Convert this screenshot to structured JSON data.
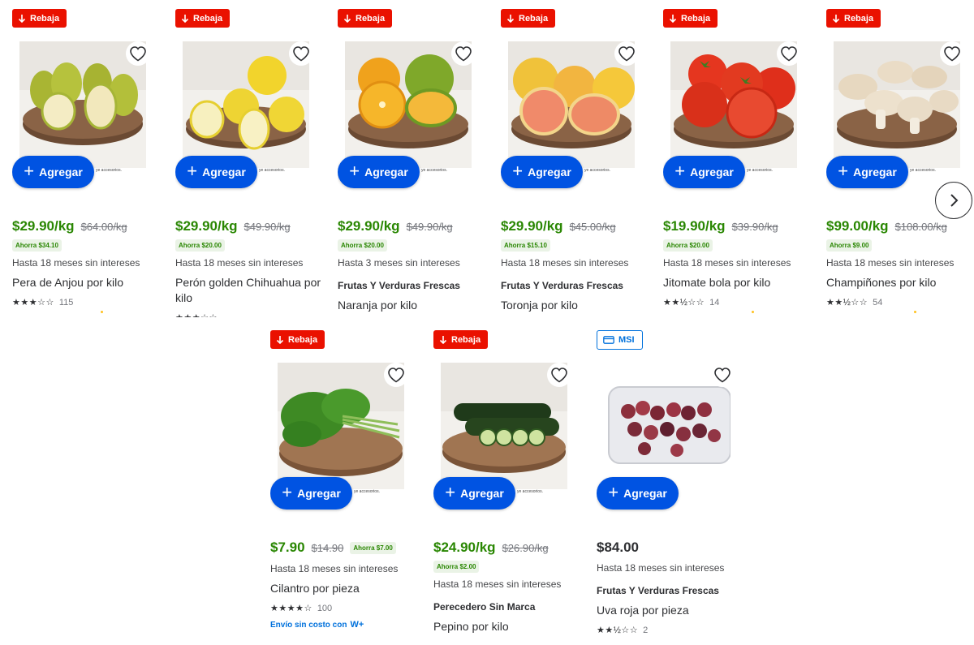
{
  "add_label": "Agregar",
  "disclaimer": "ye accesorios.",
  "flags": {
    "rebaja": "Rebaja",
    "msi": "MSI"
  },
  "colors": {
    "rebaja": "#ea1100",
    "price_green": "#2a8703",
    "button_blue": "#0053e2",
    "link_blue": "#0071dc"
  },
  "products": [
    {
      "flag": "Rebaja",
      "price": "$29.90/kg",
      "was": "$64.00/kg",
      "save": "Ahorra $34.10",
      "msi": "Hasta 18 meses sin intereses",
      "brand": "",
      "name": "Pera de Anjou por kilo",
      "stars": "★★★☆☆",
      "reviews": "115",
      "image": "pears"
    },
    {
      "flag": "Rebaja",
      "price": "$29.90/kg",
      "was": "$49.90/kg",
      "save": "Ahorra $20.00",
      "msi": "Hasta 18 meses sin intereses",
      "brand": "",
      "name": "Perón golden Chihuahua por kilo",
      "stars": "★★★☆☆",
      "reviews": "",
      "image": "yellow-apples"
    },
    {
      "flag": "Rebaja",
      "price": "$29.90/kg",
      "was": "$49.90/kg",
      "save": "Ahorra $20.00",
      "msi": "Hasta 3 meses sin intereses",
      "brand": "Frutas Y Verduras Frescas",
      "name": "Naranja por kilo",
      "stars": "",
      "reviews": "",
      "image": "oranges"
    },
    {
      "flag": "Rebaja",
      "price": "$29.90/kg",
      "was": "$45.00/kg",
      "save": "Ahorra $15.10",
      "msi": "Hasta 18 meses sin intereses",
      "brand": "Frutas Y Verduras Frescas",
      "name": "Toronja por kilo",
      "stars": "",
      "reviews": "",
      "image": "grapefruit"
    },
    {
      "flag": "Rebaja",
      "price": "$19.90/kg",
      "was": "$39.90/kg",
      "save": "Ahorra $20.00",
      "msi": "Hasta 18 meses sin intereses",
      "brand": "",
      "name": "Jitomate bola por kilo",
      "stars": "★★½☆☆",
      "reviews": "14",
      "image": "tomatoes"
    },
    {
      "flag": "Rebaja",
      "price": "$99.00/kg",
      "was": "$108.00/kg",
      "save": "Ahorra $9.00",
      "msi": "Hasta 18 meses sin intereses",
      "brand": "",
      "name": "Champiñones por kilo",
      "stars": "★★½☆☆",
      "reviews": "54",
      "image": "mushrooms"
    },
    {
      "flag": "Rebaja",
      "price": "$7.90",
      "was": "$14.90",
      "save": "Ahorra $7.00",
      "msi": "Hasta 18 meses sin intereses",
      "brand": "",
      "name": "Cilantro por pieza",
      "stars": "★★★★☆",
      "reviews": "100",
      "shipping": "Envío sin costo con",
      "shipping_badge": "W+",
      "image": "cilantro"
    },
    {
      "flag": "Rebaja",
      "price": "$24.90/kg",
      "was": "$26.90/kg",
      "save": "Ahorra $2.00",
      "msi": "Hasta 18 meses sin intereses",
      "brand": "Perecedero Sin Marca",
      "name": "Pepino por kilo",
      "stars": "",
      "reviews": "",
      "image": "cucumbers"
    },
    {
      "flag": "MSI",
      "price": "$84.00",
      "was": "",
      "save": "",
      "msi": "Hasta 18 meses sin intereses",
      "brand": "Frutas Y Verduras Frescas",
      "name": "Uva roja por pieza",
      "stars": "★★½☆☆",
      "reviews": "2",
      "image": "red-grapes"
    }
  ]
}
